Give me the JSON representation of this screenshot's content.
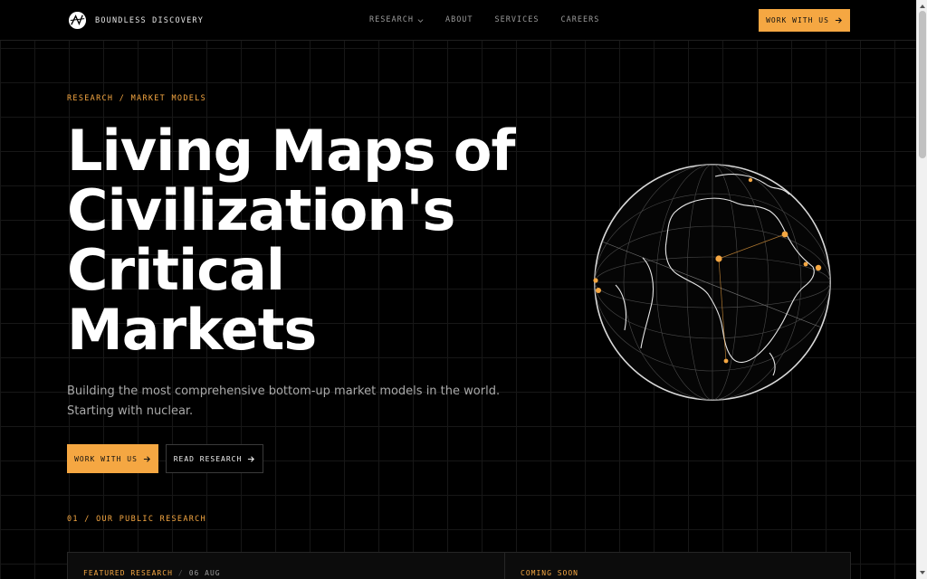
{
  "brand": {
    "name": "BOUNDLESS DISCOVERY",
    "icon": "globe-logo-icon"
  },
  "nav": {
    "items": [
      {
        "label": "RESEARCH",
        "has_dropdown": true
      },
      {
        "label": "ABOUT"
      },
      {
        "label": "SERVICES"
      },
      {
        "label": "CAREERS"
      }
    ],
    "cta_label": "WORK WITH US"
  },
  "hero": {
    "breadcrumb": "RESEARCH / MARKET MODELS",
    "title_lines": [
      "Living Maps of",
      "Civilization's",
      "Critical",
      "Markets"
    ],
    "subtitle_lines": [
      "Building the most comprehensive bottom-up market models in the world.",
      "Starting with nuclear."
    ],
    "primary_button": "WORK WITH US",
    "secondary_button": "READ RESEARCH"
  },
  "research": {
    "section_label": "01 / OUR PUBLIC RESEARCH",
    "cards": [
      {
        "tag": "FEATURED RESEARCH",
        "date": "06 AUG"
      },
      {
        "tag": "COMING SOON"
      }
    ]
  },
  "colors": {
    "accent": "#f5a742",
    "background": "#000000",
    "text": "#ffffff",
    "muted": "#a9a9a9"
  }
}
